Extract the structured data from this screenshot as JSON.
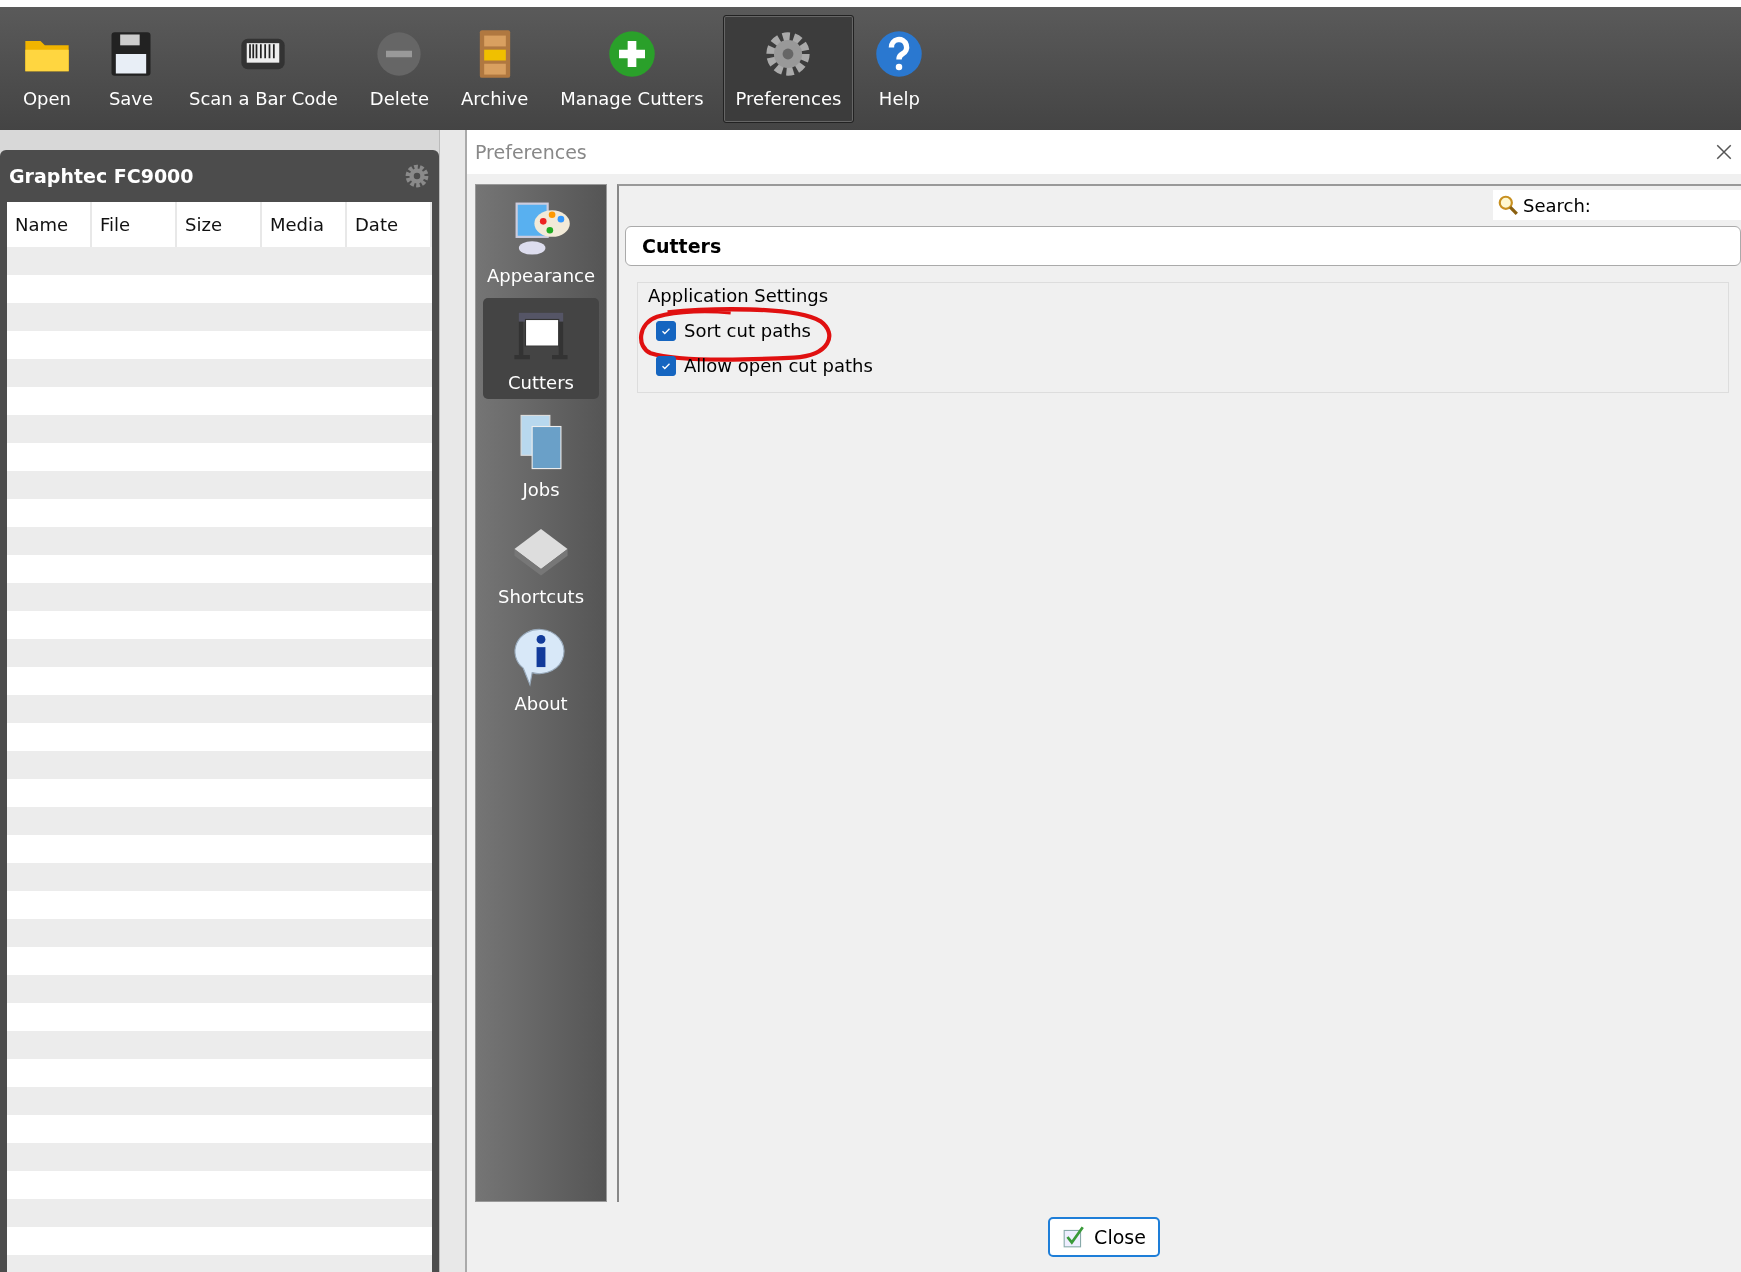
{
  "toolbar": [
    {
      "label": "Open",
      "selected": false
    },
    {
      "label": "Save",
      "selected": false
    },
    {
      "label": "Scan a Bar Code",
      "selected": false
    },
    {
      "label": "Delete",
      "selected": false
    },
    {
      "label": "Archive",
      "selected": false
    },
    {
      "label": "Manage Cutters",
      "selected": false
    },
    {
      "label": "Preferences",
      "selected": true
    },
    {
      "label": "Help",
      "selected": false
    }
  ],
  "left_panel": {
    "title": "Graphtec FC9000",
    "table": {
      "columns": [
        "Name",
        "File",
        "Size",
        "Media",
        "Date"
      ]
    }
  },
  "dialog": {
    "title": "Preferences",
    "sidebar": [
      {
        "label": "Appearance",
        "selected": false
      },
      {
        "label": "Cutters",
        "selected": true
      },
      {
        "label": "Jobs",
        "selected": false
      },
      {
        "label": "Shortcuts",
        "selected": false
      },
      {
        "label": "About",
        "selected": false
      }
    ],
    "search": {
      "label": "Search:"
    },
    "section_title": "Cutters",
    "group": {
      "title": "Application Settings",
      "options": [
        {
          "label": "Sort cut paths",
          "checked": true,
          "circled": true
        },
        {
          "label": "Allow open cut paths",
          "checked": true,
          "circled": false
        }
      ]
    },
    "close_button": "Close"
  }
}
